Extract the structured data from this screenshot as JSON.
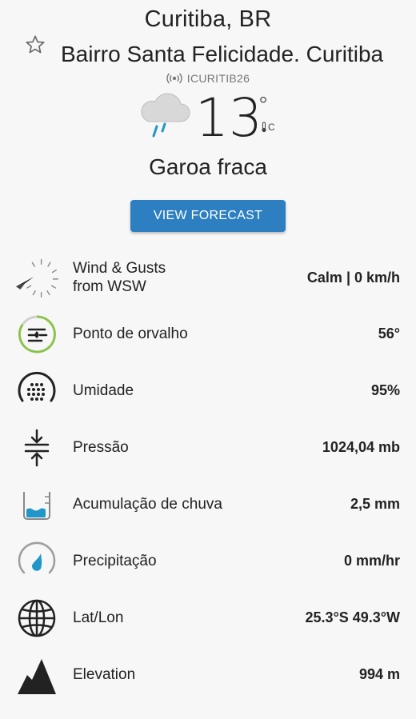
{
  "header": {
    "city": "Curitiba, BR",
    "neighborhood": "Bairro Santa Felicidade. Curitiba",
    "station_id": "ICURITIB26",
    "temperature": "13",
    "degree_symbol": "°",
    "unit": "C",
    "condition": "Garoa fraca",
    "forecast_button_label": "VIEW FORECAST"
  },
  "colors": {
    "accent": "#2d7fc1",
    "dew_ring": "#8bc34a",
    "rain_blue": "#2196c9"
  },
  "icons": {
    "favorite": "star-outline-icon",
    "station": "broadcast-icon",
    "condition": "rain-cloud-icon"
  },
  "rows": [
    {
      "id": "wind",
      "label_line1": "Wind & Gusts",
      "label_line2": "from WSW",
      "value": "Calm | 0 km/h",
      "icon": "wind-compass-icon"
    },
    {
      "id": "dew",
      "label": "Ponto de orvalho",
      "value": "56°",
      "icon": "dew-point-icon"
    },
    {
      "id": "humidity",
      "label": "Umidade",
      "value": "95%",
      "icon": "humidity-icon"
    },
    {
      "id": "pressure",
      "label": "Pressão",
      "value": "1024,04 mb",
      "icon": "pressure-icon"
    },
    {
      "id": "rain-acc",
      "label": "Acumulação de chuva",
      "value": "2,5 mm",
      "icon": "rain-gauge-icon"
    },
    {
      "id": "precip",
      "label": "Precipitação",
      "value": "0 mm/hr",
      "icon": "precipitation-icon"
    },
    {
      "id": "latlon",
      "label": "Lat/Lon",
      "value": "25.3°S 49.3°W",
      "icon": "globe-icon"
    },
    {
      "id": "elevation",
      "label": "Elevation",
      "value": "994 m",
      "icon": "mountain-icon"
    }
  ]
}
